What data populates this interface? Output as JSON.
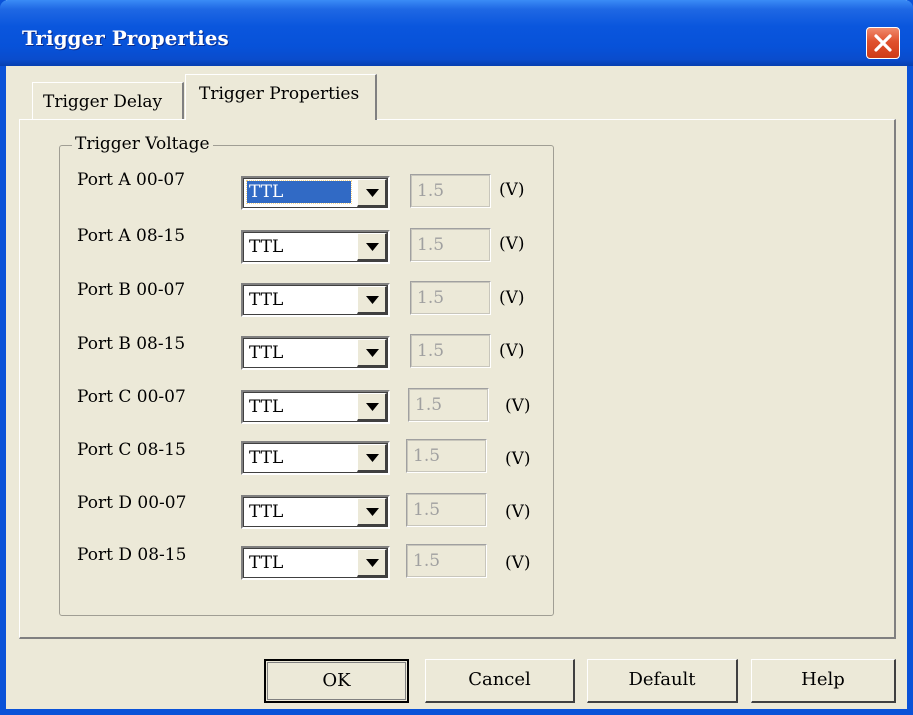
{
  "window": {
    "title": "Trigger Properties"
  },
  "tabs": [
    {
      "label": "Trigger Delay",
      "active": false
    },
    {
      "label": "Trigger Properties",
      "active": true
    }
  ],
  "trigger_voltage": {
    "group_title": "Trigger Voltage",
    "rows": [
      {
        "port": "Port A 00-07",
        "mode": "TTL",
        "voltage": "1.5",
        "unit": "(V)",
        "selected": true
      },
      {
        "port": "Port A 08-15",
        "mode": "TTL",
        "voltage": "1.5",
        "unit": "(V)"
      },
      {
        "port": "Port B 00-07",
        "mode": "TTL",
        "voltage": "1.5",
        "unit": "(V)"
      },
      {
        "port": "Port B 08-15",
        "mode": "TTL",
        "voltage": "1.5",
        "unit": "(V)"
      },
      {
        "port": "Port C 00-07",
        "mode": "TTL",
        "voltage": "1.5",
        "unit": "(V)"
      },
      {
        "port": "Port C 08-15",
        "mode": "TTL",
        "voltage": "1.5",
        "unit": "(V)"
      },
      {
        "port": "Port D 00-07",
        "mode": "TTL",
        "voltage": "1.5",
        "unit": "(V)"
      },
      {
        "port": "Port D 08-15",
        "mode": "TTL",
        "voltage": "1.5",
        "unit": "(V)"
      }
    ]
  },
  "buttons": {
    "ok": "OK",
    "cancel": "Cancel",
    "default": "Default",
    "help": "Help"
  },
  "colors": {
    "titlebar": "#0a56dd",
    "dialog_bg": "#ece9d8",
    "close_button": "#e0512d",
    "selection": "#316ac5"
  },
  "icons": {
    "close": "close-icon",
    "dropdown": "chevron-down-icon"
  }
}
